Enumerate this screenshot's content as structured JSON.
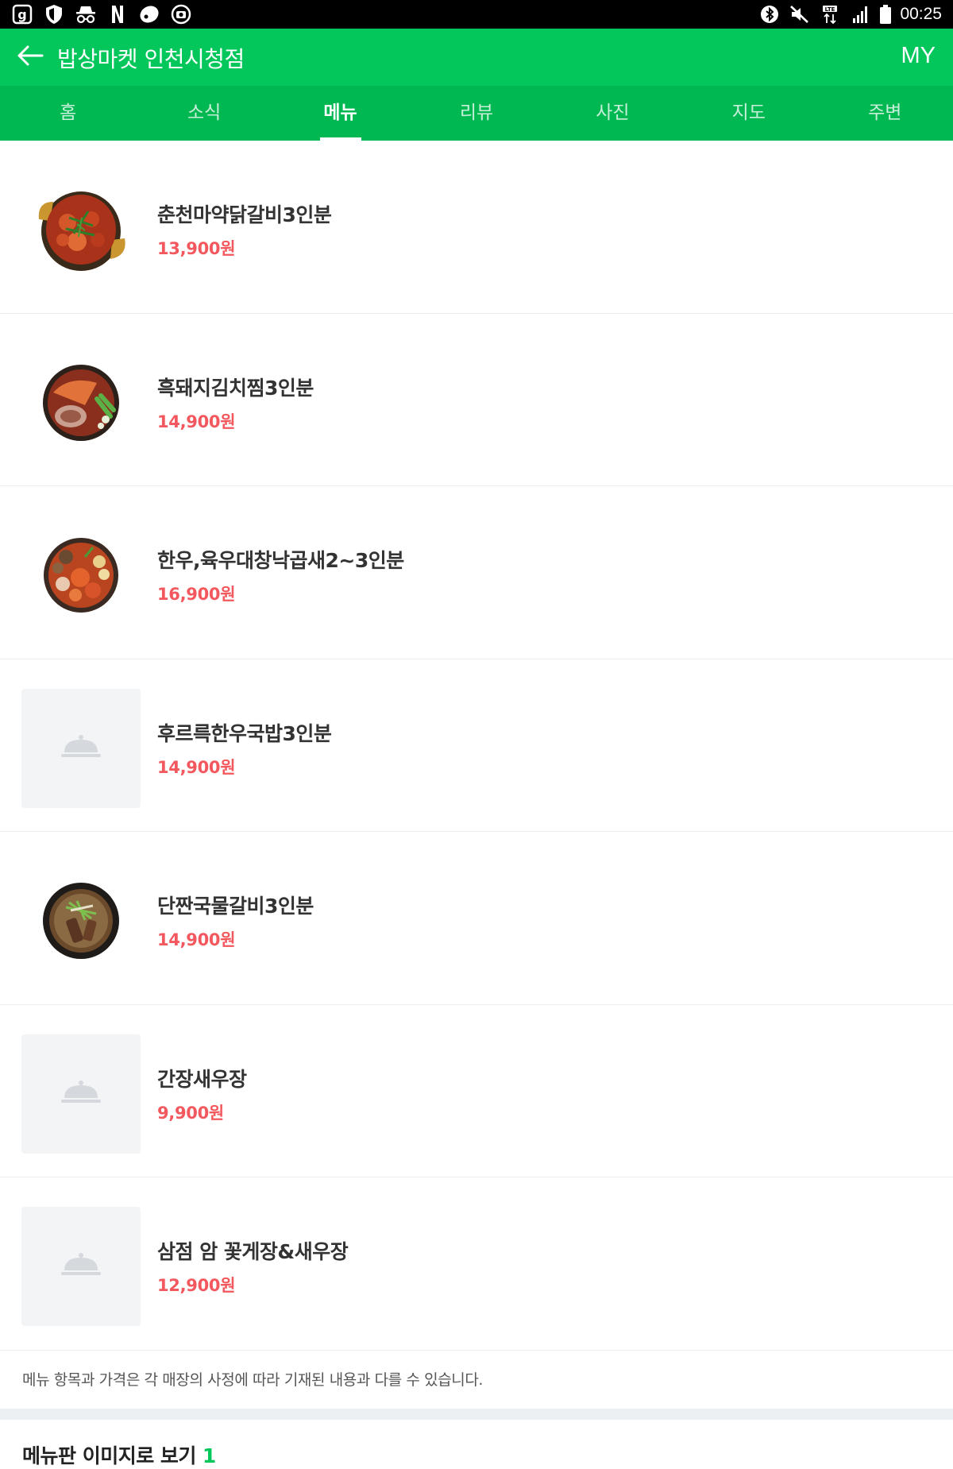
{
  "status_bar": {
    "time": "00:25",
    "left_icons": [
      "g-app-icon",
      "shield-icon",
      "incognito-icon",
      "netflix-icon",
      "oval-app-icon",
      "camera-app-icon"
    ],
    "right_icons": [
      "bluetooth-icon",
      "mute-icon",
      "lte-icon",
      "signal-icon",
      "battery-icon"
    ]
  },
  "app_bar": {
    "title": "밥상마켓 인천시청점",
    "my_label": "MY"
  },
  "tabs": [
    {
      "label": "홈",
      "active": false
    },
    {
      "label": "소식",
      "active": false
    },
    {
      "label": "메뉴",
      "active": true
    },
    {
      "label": "리뷰",
      "active": false
    },
    {
      "label": "사진",
      "active": false
    },
    {
      "label": "지도",
      "active": false
    },
    {
      "label": "주변",
      "active": false
    }
  ],
  "menu": {
    "items": [
      {
        "name": "춘천마약닭갈비3인분",
        "price": "13,900원",
        "photo": "spicy-chicken-galbi-photo"
      },
      {
        "name": "흑돼지김치찜3인분",
        "price": "14,900원",
        "photo": "kimchi-stew-pork-photo"
      },
      {
        "name": "한우,육우대창낙곱새2~3인분",
        "price": "16,900원",
        "photo": "nakgopsae-hotpot-photo"
      },
      {
        "name": "후르륵한우국밥3인분",
        "price": "14,900원",
        "photo": "no-image-placeholder"
      },
      {
        "name": "단짠국물갈비3인분",
        "price": "14,900원",
        "photo": "galbi-soup-photo"
      },
      {
        "name": "간장새우장",
        "price": "9,900원",
        "photo": "no-image-placeholder"
      },
      {
        "name": "삼점 암 꽃게장&새우장",
        "price": "12,900원",
        "photo": "no-image-placeholder"
      }
    ],
    "notice": "메뉴 항목과 가격은 각 매장의 사정에 따라 기재된 내용과 다를 수 있습니다.",
    "board_title": "메뉴판 이미지로 보기",
    "board_count": "1"
  },
  "colors": {
    "app_bar": "#03c75a",
    "tab_bar": "#00b852",
    "price": "#f2585e",
    "placeholder_bg": "#f2f4f6"
  }
}
